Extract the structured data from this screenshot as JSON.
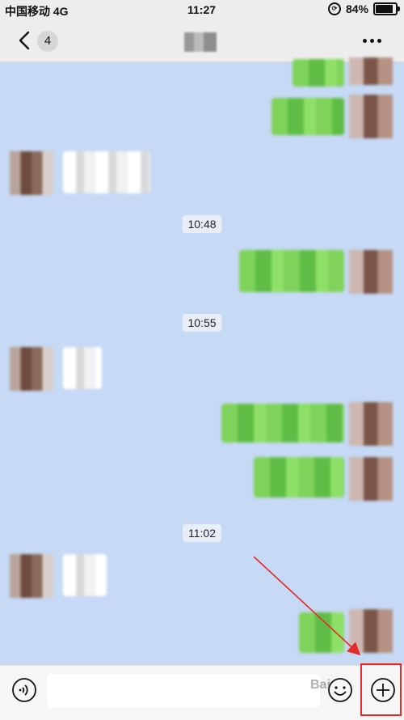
{
  "status_bar": {
    "carrier": "中国移动 4G",
    "time": "11:27",
    "battery": "84%"
  },
  "nav": {
    "back_count": "4"
  },
  "timestamps": [
    "10:48",
    "10:55",
    "11:02"
  ],
  "input": {
    "placeholder": ""
  },
  "icons": {
    "back": "chevron-left-icon",
    "more": "more-icon",
    "voice": "voice-icon",
    "emoji": "emoji-icon",
    "plus": "plus-icon"
  },
  "colors": {
    "chat_bg": "#c6d9f5",
    "my_bubble": "#7fd35a",
    "annotation": "#e32b2b"
  },
  "watermark": "Bai"
}
